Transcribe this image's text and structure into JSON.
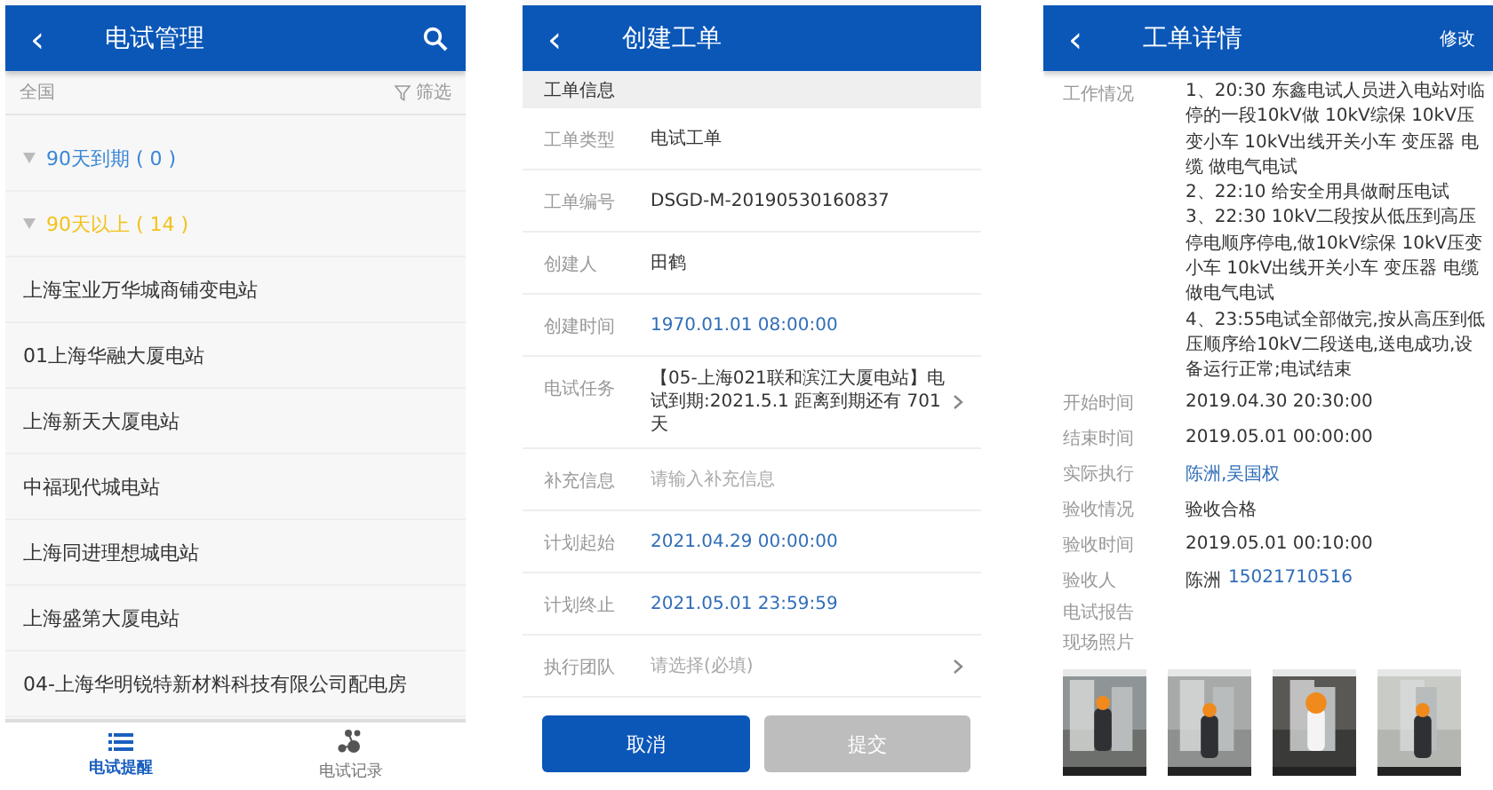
{
  "list_screen": {
    "title": "电试管理",
    "back": "‹",
    "filter_bar": {
      "region": "全国",
      "filter": "筛选"
    },
    "groups": [
      {
        "label": "90天到期 ( 0 )",
        "color": "#3a86d6",
        "expanded": true
      },
      {
        "label": "90天以上 ( 14 )",
        "color": "#f2c21b",
        "expanded": true
      }
    ],
    "items": [
      "上海宝业万华城商铺变电站",
      "01上海华融大厦电站",
      "上海新天大厦电站",
      "中福现代城电站",
      "上海同进理想城电站",
      "上海盛第大厦电站",
      "04-上海华明锐特新材料科技有限公司配电房"
    ],
    "tabs": [
      {
        "label": "电试提醒",
        "selected": true
      },
      {
        "label": "电试记录",
        "selected": false
      }
    ]
  },
  "form_screen": {
    "title": "创建工单",
    "back": "‹",
    "section": "工单信息",
    "rows": [
      {
        "kind": "text",
        "label": "工单类型",
        "value": "电试工单"
      },
      {
        "kind": "text",
        "label": "工单编号",
        "value": "DSGD-M-20190530160837"
      },
      {
        "kind": "text",
        "label": "创建人",
        "value": "田鹤"
      },
      {
        "kind": "date",
        "label": "创建时间",
        "value": "1970.01.01 08:00:00"
      },
      {
        "kind": "picker",
        "label": "电试任务",
        "value": "【05-上海021联和滨江大厦电站】电试到期:2021.5.1  距离到期还有 701 天"
      },
      {
        "kind": "input",
        "label": "补充信息",
        "placeholder": "请输入补充信息"
      },
      {
        "kind": "date",
        "label": "计划起始",
        "value": "2021.04.29 00:00:00"
      },
      {
        "kind": "date",
        "label": "计划终止",
        "value": "2021.05.01 23:59:59"
      },
      {
        "kind": "picker",
        "label": "执行团队",
        "placeholder": "请选择(必填)"
      }
    ],
    "buttons": [
      {
        "label": "取消",
        "disabled": false
      },
      {
        "label": "提交",
        "disabled": true
      }
    ]
  },
  "detail_screen": {
    "title": "工单详情",
    "back": "‹",
    "action": "修改",
    "work": {
      "label": "工作情况",
      "lines": [
        "1、20:30 东鑫电试人员进入电站对临停的一段10kV做 10kV综保 10kV压变小车    10kV出线开关小车 变压器 电缆 做电气电试",
        "2、22:10 给安全用具做耐压电试",
        "3、22:30 10kV二段按从低压到高压停电顺序停电,做10kV综保 10kV压变小车 10kV出线开关小车 变压器 电缆做电气电试",
        "4、23:55电试全部做完,按从高压到低压顺序给10kV二段送电,送电成功,设备运行正常;电试结束"
      ]
    },
    "fields": [
      {
        "label": "开始时间",
        "parts": [
          {
            "text": "2019.04.30 20:30:00",
            "link": false
          }
        ]
      },
      {
        "label": "结束时间",
        "parts": [
          {
            "text": "2019.05.01 00:00:00",
            "link": false
          }
        ]
      },
      {
        "label": "实际执行",
        "parts": [
          {
            "text": "陈洲,吴国权",
            "link": true
          }
        ]
      },
      {
        "label": "验收情况",
        "parts": [
          {
            "text": "验收合格",
            "link": false
          }
        ]
      },
      {
        "label": "验收时间",
        "parts": [
          {
            "text": "2019.05.01 00:10:00",
            "link": false
          }
        ]
      },
      {
        "label": "验收人",
        "parts": [
          {
            "text": "陈洲",
            "link": false
          },
          {
            "text": "15021710516",
            "link": true
          }
        ]
      }
    ],
    "report_label": "电试报告",
    "photos_label": "现场照片"
  }
}
